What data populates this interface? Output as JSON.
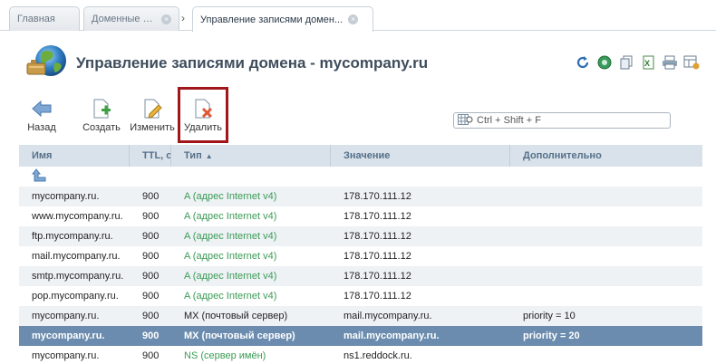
{
  "tabs": [
    {
      "label": "Главная"
    },
    {
      "label": "Доменные и..."
    },
    {
      "label": "Управление записями домен..."
    }
  ],
  "page": {
    "title": "Управление записями домена - mycompany.ru"
  },
  "header_tools": [
    "refresh-icon",
    "globe-gear-icon",
    "copy-icon",
    "excel-icon",
    "print-icon",
    "table-settings-icon"
  ],
  "toolbar": {
    "back_label": "Назад",
    "create_label": "Создать",
    "edit_label": "Изменить",
    "delete_label": "Удалить"
  },
  "search": {
    "placeholder": "Ctrl + Shift + F"
  },
  "grid": {
    "columns": [
      "Имя",
      "TTL, с",
      "Тип",
      "Значение",
      "Дополнительно"
    ],
    "rows": [
      {
        "name": "mycompany.ru.",
        "ttl": "900",
        "type": "A (адрес Internet v4)",
        "value": "178.170.111.12",
        "extra": ""
      },
      {
        "name": "www.mycompany.ru.",
        "ttl": "900",
        "type": "A (адрес Internet v4)",
        "value": "178.170.111.12",
        "extra": ""
      },
      {
        "name": "ftp.mycompany.ru.",
        "ttl": "900",
        "type": "A (адрес Internet v4)",
        "value": "178.170.111.12",
        "extra": ""
      },
      {
        "name": "mail.mycompany.ru.",
        "ttl": "900",
        "type": "A (адрес Internet v4)",
        "value": "178.170.111.12",
        "extra": ""
      },
      {
        "name": "smtp.mycompany.ru.",
        "ttl": "900",
        "type": "A (адрес Internet v4)",
        "value": "178.170.111.12",
        "extra": ""
      },
      {
        "name": "pop.mycompany.ru.",
        "ttl": "900",
        "type": "A (адрес Internet v4)",
        "value": "178.170.111.12",
        "extra": ""
      },
      {
        "name": "mycompany.ru.",
        "ttl": "900",
        "type": "MX (почтовый сервер)",
        "value": "mail.mycompany.ru.",
        "extra": "priority = 10"
      },
      {
        "name": "mycompany.ru.",
        "ttl": "900",
        "type": "MX (почтовый сервер)",
        "value": "mail.mycompany.ru.",
        "extra": "priority = 20"
      },
      {
        "name": "mycompany.ru.",
        "ttl": "900",
        "type": "NS (сервер имён)",
        "value": "ns1.reddock.ru.",
        "extra": ""
      }
    ]
  },
  "colors": {
    "highlight_border": "#a0161b",
    "selected_row": "#6b8cae",
    "header_bg": "#d9e2ea",
    "type_green": "#3b9b55"
  }
}
